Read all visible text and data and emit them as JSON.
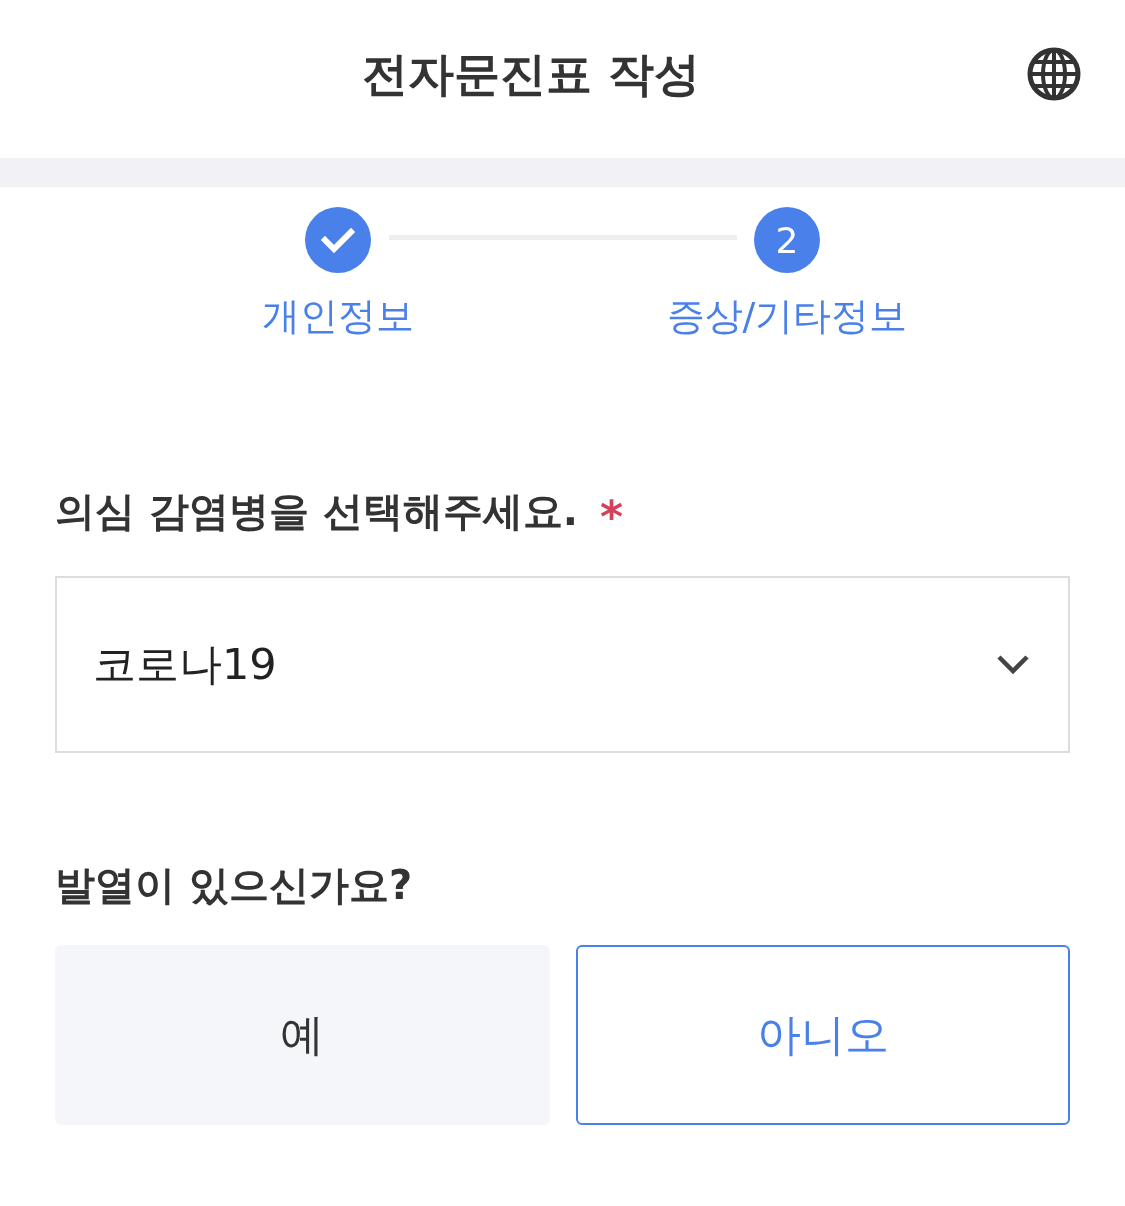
{
  "header": {
    "title": "전자문진표 작성"
  },
  "steps": [
    {
      "label": "개인정보",
      "completed": true
    },
    {
      "label": "증상/기타정보",
      "number": "2",
      "completed": false
    }
  ],
  "questions": [
    {
      "kind": "select",
      "label": "의심 감염병을 선택해주세요.",
      "required_mark": "*",
      "value": "코로나19"
    },
    {
      "kind": "choice",
      "label": "발열이 있으신가요?",
      "options": [
        {
          "label": "예",
          "selected": false
        },
        {
          "label": "아니오",
          "selected": true
        }
      ]
    }
  ]
}
